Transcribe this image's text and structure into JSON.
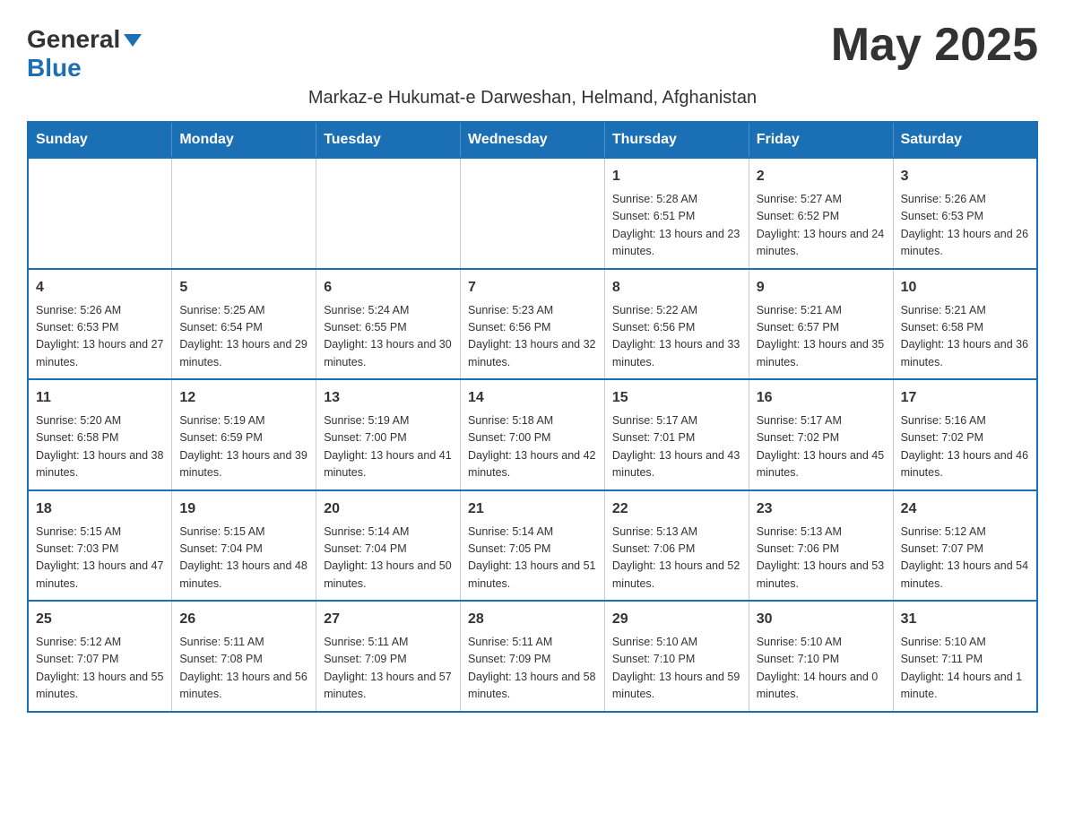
{
  "header": {
    "logo_general": "General",
    "logo_blue": "Blue",
    "month_title": "May 2025",
    "subtitle": "Markaz-e Hukumat-e Darweshan, Helmand, Afghanistan"
  },
  "weekdays": [
    "Sunday",
    "Monday",
    "Tuesday",
    "Wednesday",
    "Thursday",
    "Friday",
    "Saturday"
  ],
  "weeks": [
    [
      {
        "day": "",
        "info": ""
      },
      {
        "day": "",
        "info": ""
      },
      {
        "day": "",
        "info": ""
      },
      {
        "day": "",
        "info": ""
      },
      {
        "day": "1",
        "info": "Sunrise: 5:28 AM\nSunset: 6:51 PM\nDaylight: 13 hours and 23 minutes."
      },
      {
        "day": "2",
        "info": "Sunrise: 5:27 AM\nSunset: 6:52 PM\nDaylight: 13 hours and 24 minutes."
      },
      {
        "day": "3",
        "info": "Sunrise: 5:26 AM\nSunset: 6:53 PM\nDaylight: 13 hours and 26 minutes."
      }
    ],
    [
      {
        "day": "4",
        "info": "Sunrise: 5:26 AM\nSunset: 6:53 PM\nDaylight: 13 hours and 27 minutes."
      },
      {
        "day": "5",
        "info": "Sunrise: 5:25 AM\nSunset: 6:54 PM\nDaylight: 13 hours and 29 minutes."
      },
      {
        "day": "6",
        "info": "Sunrise: 5:24 AM\nSunset: 6:55 PM\nDaylight: 13 hours and 30 minutes."
      },
      {
        "day": "7",
        "info": "Sunrise: 5:23 AM\nSunset: 6:56 PM\nDaylight: 13 hours and 32 minutes."
      },
      {
        "day": "8",
        "info": "Sunrise: 5:22 AM\nSunset: 6:56 PM\nDaylight: 13 hours and 33 minutes."
      },
      {
        "day": "9",
        "info": "Sunrise: 5:21 AM\nSunset: 6:57 PM\nDaylight: 13 hours and 35 minutes."
      },
      {
        "day": "10",
        "info": "Sunrise: 5:21 AM\nSunset: 6:58 PM\nDaylight: 13 hours and 36 minutes."
      }
    ],
    [
      {
        "day": "11",
        "info": "Sunrise: 5:20 AM\nSunset: 6:58 PM\nDaylight: 13 hours and 38 minutes."
      },
      {
        "day": "12",
        "info": "Sunrise: 5:19 AM\nSunset: 6:59 PM\nDaylight: 13 hours and 39 minutes."
      },
      {
        "day": "13",
        "info": "Sunrise: 5:19 AM\nSunset: 7:00 PM\nDaylight: 13 hours and 41 minutes."
      },
      {
        "day": "14",
        "info": "Sunrise: 5:18 AM\nSunset: 7:00 PM\nDaylight: 13 hours and 42 minutes."
      },
      {
        "day": "15",
        "info": "Sunrise: 5:17 AM\nSunset: 7:01 PM\nDaylight: 13 hours and 43 minutes."
      },
      {
        "day": "16",
        "info": "Sunrise: 5:17 AM\nSunset: 7:02 PM\nDaylight: 13 hours and 45 minutes."
      },
      {
        "day": "17",
        "info": "Sunrise: 5:16 AM\nSunset: 7:02 PM\nDaylight: 13 hours and 46 minutes."
      }
    ],
    [
      {
        "day": "18",
        "info": "Sunrise: 5:15 AM\nSunset: 7:03 PM\nDaylight: 13 hours and 47 minutes."
      },
      {
        "day": "19",
        "info": "Sunrise: 5:15 AM\nSunset: 7:04 PM\nDaylight: 13 hours and 48 minutes."
      },
      {
        "day": "20",
        "info": "Sunrise: 5:14 AM\nSunset: 7:04 PM\nDaylight: 13 hours and 50 minutes."
      },
      {
        "day": "21",
        "info": "Sunrise: 5:14 AM\nSunset: 7:05 PM\nDaylight: 13 hours and 51 minutes."
      },
      {
        "day": "22",
        "info": "Sunrise: 5:13 AM\nSunset: 7:06 PM\nDaylight: 13 hours and 52 minutes."
      },
      {
        "day": "23",
        "info": "Sunrise: 5:13 AM\nSunset: 7:06 PM\nDaylight: 13 hours and 53 minutes."
      },
      {
        "day": "24",
        "info": "Sunrise: 5:12 AM\nSunset: 7:07 PM\nDaylight: 13 hours and 54 minutes."
      }
    ],
    [
      {
        "day": "25",
        "info": "Sunrise: 5:12 AM\nSunset: 7:07 PM\nDaylight: 13 hours and 55 minutes."
      },
      {
        "day": "26",
        "info": "Sunrise: 5:11 AM\nSunset: 7:08 PM\nDaylight: 13 hours and 56 minutes."
      },
      {
        "day": "27",
        "info": "Sunrise: 5:11 AM\nSunset: 7:09 PM\nDaylight: 13 hours and 57 minutes."
      },
      {
        "day": "28",
        "info": "Sunrise: 5:11 AM\nSunset: 7:09 PM\nDaylight: 13 hours and 58 minutes."
      },
      {
        "day": "29",
        "info": "Sunrise: 5:10 AM\nSunset: 7:10 PM\nDaylight: 13 hours and 59 minutes."
      },
      {
        "day": "30",
        "info": "Sunrise: 5:10 AM\nSunset: 7:10 PM\nDaylight: 14 hours and 0 minutes."
      },
      {
        "day": "31",
        "info": "Sunrise: 5:10 AM\nSunset: 7:11 PM\nDaylight: 14 hours and 1 minute."
      }
    ]
  ]
}
